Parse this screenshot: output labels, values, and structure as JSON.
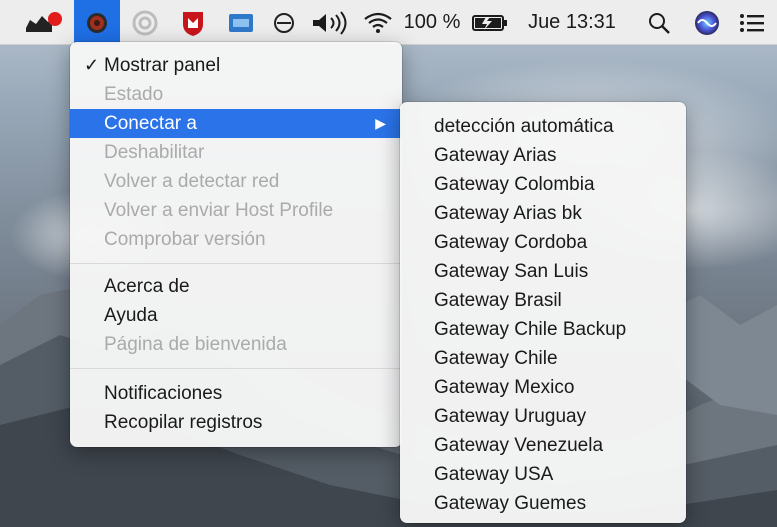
{
  "menubar": {
    "battery_percent": "100 %",
    "clock": "Jue 13:31",
    "icons": [
      "spy-agent-icon",
      "vpn-client-icon",
      "creative-cloud-icon",
      "mcafee-shield-icon",
      "display-icon",
      "do-not-disturb-icon",
      "volume-icon",
      "wifi-icon",
      "battery-icon",
      "spotlight-icon",
      "siri-icon",
      "notification-center-icon"
    ],
    "active_color": "#1f6fe5"
  },
  "main_menu": {
    "items": [
      {
        "label": "Mostrar panel",
        "checked": true,
        "enabled": true
      },
      {
        "label": "Estado",
        "enabled": false
      },
      {
        "label": "Conectar a",
        "enabled": true,
        "highlighted": true,
        "submenu": true
      },
      {
        "label": "Deshabilitar",
        "enabled": false
      },
      {
        "label": "Volver a detectar red",
        "enabled": false
      },
      {
        "label": "Volver a enviar Host Profile",
        "enabled": false
      },
      {
        "label": "Comprobar versión",
        "enabled": false
      },
      {
        "label": "Acerca de",
        "enabled": true
      },
      {
        "label": "Ayuda",
        "enabled": true
      },
      {
        "label": "Página de bienvenida",
        "enabled": false
      },
      {
        "label": "Notificaciones",
        "enabled": true
      },
      {
        "label": "Recopilar registros",
        "enabled": true
      }
    ],
    "highlight_color": "#2a73e8"
  },
  "submenu": {
    "items": [
      {
        "label": "detección automática"
      },
      {
        "label": "Gateway Arias"
      },
      {
        "label": "Gateway Colombia"
      },
      {
        "label": "Gateway Arias bk"
      },
      {
        "label": "Gateway Cordoba"
      },
      {
        "label": "Gateway San Luis"
      },
      {
        "label": "Gateway Brasil"
      },
      {
        "label": "Gateway Chile Backup"
      },
      {
        "label": "Gateway Chile"
      },
      {
        "label": "Gateway Mexico"
      },
      {
        "label": "Gateway Uruguay"
      },
      {
        "label": "Gateway Venezuela"
      },
      {
        "label": "Gateway USA"
      },
      {
        "label": "Gateway Guemes"
      }
    ]
  }
}
